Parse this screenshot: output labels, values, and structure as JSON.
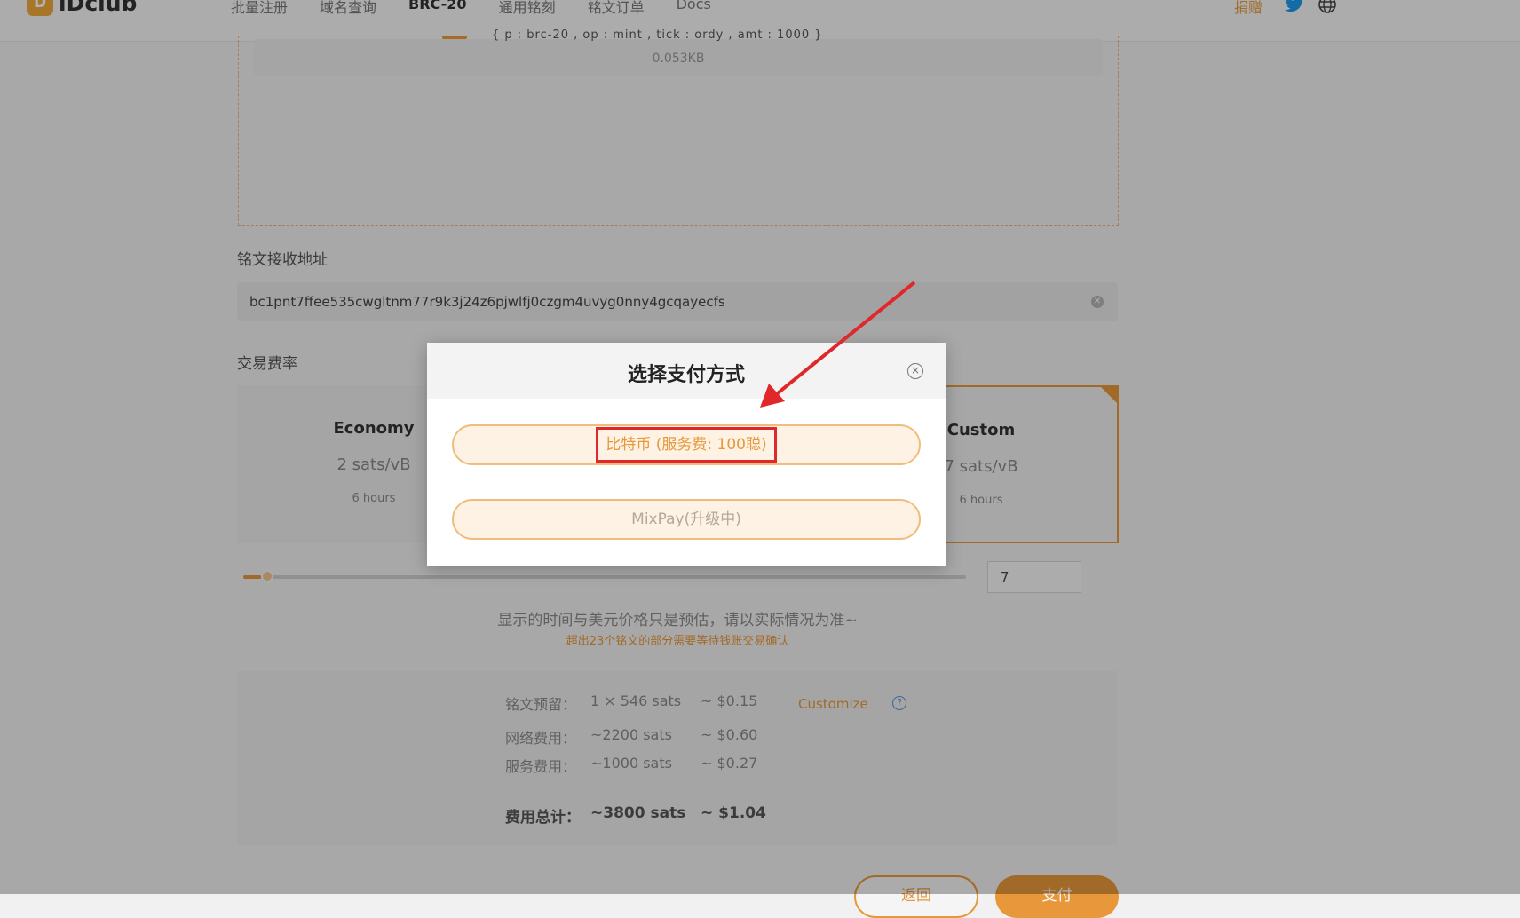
{
  "header": {
    "logo_text": "iDclub",
    "nav": [
      "批量注册",
      "域名查询",
      "BRC-20",
      "通用铭刻",
      "铭文订单",
      "Docs"
    ],
    "donate": "捐赠"
  },
  "inscription": {
    "content": "{ p : brc-20 , op : mint , tick : ordy , amt : 1000 }",
    "size": "0.053KB"
  },
  "receive": {
    "label": "铭文接收地址",
    "address": "bc1pnt7ffee535cwgltnm77r9k3j24z6pjwlfj0czgm4uvyg0nny4gcqayecfs"
  },
  "fee": {
    "label": "交易费率",
    "cards": [
      {
        "title": "Economy",
        "rate": "2 sats/vB",
        "time": "6 hours"
      },
      {
        "title": "Custom",
        "rate": "7 sats/vB",
        "time": "6 hours"
      }
    ],
    "selected": "Custom",
    "custom_value": "7",
    "slider_fraction": 0.02,
    "hint": "显示的时间与美元价格只是预估，请以实际情况为准~",
    "warning": "超出23个铭文的部分需要等待钱账交易确认"
  },
  "summary": {
    "rows": [
      {
        "key": "铭文预留：",
        "sats": "1 × 546  sats",
        "usd": "~ $0.15"
      },
      {
        "key": "网络费用：",
        "sats": "~2200  sats",
        "usd": "~ $0.60"
      },
      {
        "key": "服务费用：",
        "sats": "~1000  sats",
        "usd": "~ $0.27"
      }
    ],
    "total": {
      "key": "费用总计：",
      "sats": "~3800  sats",
      "usd": "~ $1.04"
    },
    "customize": "Customize",
    "help": "?"
  },
  "actions": {
    "back": "返回",
    "pay": "支付"
  },
  "modal": {
    "title": "选择支付方式",
    "close": "×",
    "options": [
      "比特币 (服务费: 100聪)",
      "MixPay(升级中)"
    ]
  },
  "colors": {
    "accent": "#e8983a",
    "highlight": "#e0282a",
    "twitter": "#1d9bf0"
  }
}
